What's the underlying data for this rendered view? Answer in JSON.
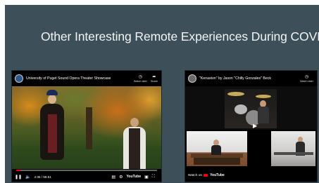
{
  "slide": {
    "title": "Other Interesting Remote Experiences During COVID"
  },
  "video1": {
    "title": "University of Puget Sound Opera Theater Showcase",
    "watch_later": "Watch later",
    "share": "Share",
    "time": "4:35 / 55:51",
    "youtube": "YouTube"
  },
  "video2": {
    "title": "\"Kenaston\" by Jason \"Chilly Gonzales\" Beck",
    "watch_later": "Watch later",
    "watch_on": "Watch on",
    "youtube": "YouTube"
  },
  "colors": {
    "panel": "#3d4f59",
    "youtube_red": "#ff0000"
  }
}
